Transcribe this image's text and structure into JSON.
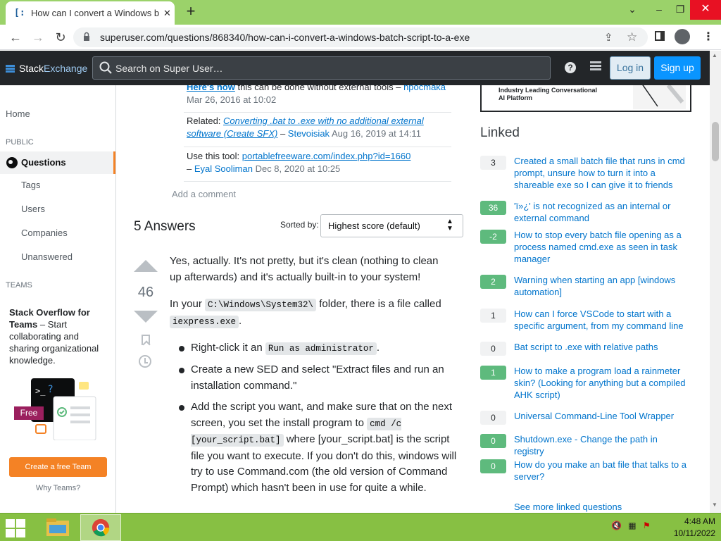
{
  "browser": {
    "tab_title": "How can I convert a Windows batch script to a .exe",
    "tab_favicon": "[:",
    "url": "superuser.com/questions/868340/how-can-i-convert-a-windows-batch-script-to-a-exe"
  },
  "header": {
    "logo_main": "Stack",
    "logo_accent": "Exchange",
    "search_placeholder": "Search on Super User…",
    "login_label": "Log in",
    "signup_label": "Sign up"
  },
  "leftnav": {
    "home": "Home",
    "public_section": "PUBLIC",
    "questions": "Questions",
    "tags": "Tags",
    "users": "Users",
    "companies": "Companies",
    "unanswered": "Unanswered",
    "teams_section": "TEAMS",
    "teams_title": "Stack Overflow for Teams",
    "teams_desc": " – Start collaborating and sharing organizational knowledge.",
    "teams_badge": "Free",
    "create_team": "Create a free Team",
    "why_teams": "Why Teams?"
  },
  "comments": [
    {
      "link": "Here's how",
      "text": " this can be done without external tools – ",
      "user": "npocmaka",
      "date": "Mar 26, 2016 at 10:02"
    },
    {
      "prefix": "Related: ",
      "link": "Converting .bat to .exe with no additional external software (Create SFX)",
      "sep": " – ",
      "user": "Stevoisiak",
      "date": "Aug 16, 2019 at 14:11"
    },
    {
      "prefix": "Use this tool: ",
      "link": "portablefreeware.com/index.php?id=1660",
      "sep": "– ",
      "user": "Eyal Sooliman",
      "date": "Dec 8, 2020 at 10:25"
    }
  ],
  "add_comment": "Add a comment",
  "answers": {
    "heading": "5 Answers",
    "sorted_by": "Sorted by:",
    "sort_value": "Highest score (default)",
    "vote_count": "46"
  },
  "answer_body": {
    "p1": "Yes, actually. It's not pretty, but it's clean (nothing to clean up afterwards) and it's actually built-in to your system!",
    "p2_a": "In your ",
    "p2_code1": "C:\\Windows\\System32\\",
    "p2_b": " folder, there is a file called",
    "p2_code2": "iexpress.exe",
    "p2_c": ".",
    "li1_a": "Right-click it an ",
    "li1_code": "Run as administrator",
    "li1_b": ".",
    "li2": "Create a new SED and select \"Extract files and run an installation command.\"",
    "li3_a": "Add the script you want, and make sure that on the next screen, you set the install program to ",
    "li3_code": "cmd /c [your_script.bat]",
    "li3_b": " where [your_script.bat] is the script file you want to execute. If you don't do this, windows will try to use Command.com (the old version of Command Prompt) which hasn't been in use for quite a while."
  },
  "ad": {
    "text": "Industry Leading Conversational AI Platform"
  },
  "linked": {
    "heading": "Linked",
    "items": [
      {
        "count": "3",
        "accepted": false,
        "title": "Created a small batch file that runs in cmd prompt, unsure how to turn it into a shareable exe so I can give it to friends"
      },
      {
        "count": "36",
        "accepted": true,
        "title": "'ï»¿' is not recognized as an internal or external command"
      },
      {
        "count": "-2",
        "accepted": true,
        "title": "How to stop every batch file opening as a process named cmd.exe as seen in task manager"
      },
      {
        "count": "2",
        "accepted": true,
        "title": "Warning when starting an app [windows automation]"
      },
      {
        "count": "1",
        "accepted": false,
        "title": "How can I force VSCode to start with a specific argument, from my command line"
      },
      {
        "count": "0",
        "accepted": false,
        "title": "Bat script to .exe with relative paths"
      },
      {
        "count": "1",
        "accepted": true,
        "title": "How to make a program load a rainmeter skin? (Looking for anything but a compiled AHK script)"
      },
      {
        "count": "0",
        "accepted": false,
        "title": "Universal Command-Line Tool Wrapper"
      },
      {
        "count": "0",
        "accepted": true,
        "title": "Shutdown.exe - Change the path in registry"
      },
      {
        "count": "0",
        "accepted": true,
        "title": "How do you make an bat file that talks to a server?"
      }
    ],
    "see_more": "See more linked questions"
  },
  "taskbar": {
    "time": "4:48 AM",
    "date": "10/11/2022"
  },
  "colors": {
    "accent_orange": "#f48225",
    "accepted_green": "#5eba7d",
    "link_blue": "#0074cc",
    "taskbar_green": "#87c043"
  }
}
